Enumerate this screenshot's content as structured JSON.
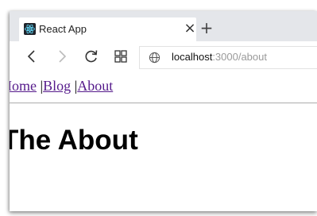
{
  "browser": {
    "tab": {
      "title": "React App",
      "favicon": "react-logo-icon",
      "close_glyph": "×"
    },
    "new_tab_glyph": "+",
    "toolbar": {
      "back_icon": "arrow-left-icon",
      "forward_icon": "arrow-right-icon",
      "reload_icon": "reload-icon",
      "grid_icon": "tab-grid-icon"
    },
    "address": {
      "host": "localhost",
      "path": ":3000/about",
      "icon": "globe-icon"
    }
  },
  "page": {
    "nav": {
      "links": [
        "Home",
        "Blog",
        "About"
      ],
      "separator": "|"
    },
    "heading": "The About"
  },
  "colors": {
    "link_visited": "#551a8b",
    "tabstrip_bg": "#e4e6ea",
    "react_blue": "#61dafb"
  }
}
